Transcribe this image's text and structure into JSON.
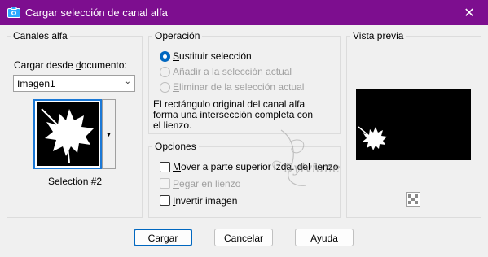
{
  "window": {
    "title": "Cargar selección de canal alfa",
    "title_icon": "camera-icon"
  },
  "canales": {
    "group_title": "Canales alfa",
    "load_label": "Cargar desde documento:",
    "document_value": "Imagen1",
    "selection_caption": "Selection #2"
  },
  "operacion": {
    "group_title": "Operación",
    "options": [
      {
        "label": "Sustituir selección",
        "checked": true,
        "enabled": true
      },
      {
        "label": "Añadir a la selección actual",
        "checked": false,
        "enabled": false
      },
      {
        "label": "Eliminar de la selección actual",
        "checked": false,
        "enabled": false
      }
    ],
    "description": [
      "El rectángulo original del canal alfa",
      "forma una intersección completa con",
      "el lienzo."
    ]
  },
  "opciones": {
    "group_title": "Opciones",
    "items": [
      {
        "label": "Mover a parte superior izda. del lienzo",
        "checked": false,
        "enabled": true
      },
      {
        "label": "Pegar en lienzo",
        "checked": false,
        "enabled": false
      },
      {
        "label": "Invertir imagen",
        "checked": false,
        "enabled": true
      }
    ]
  },
  "vista": {
    "group_title": "Vista previa"
  },
  "buttons": {
    "ok": "Cargar",
    "cancel": "Cancelar",
    "help": "Ayuda"
  },
  "watermark": "Sylviane",
  "colors": {
    "titlebar": "#7d0e8f",
    "accent": "#0067c0"
  }
}
